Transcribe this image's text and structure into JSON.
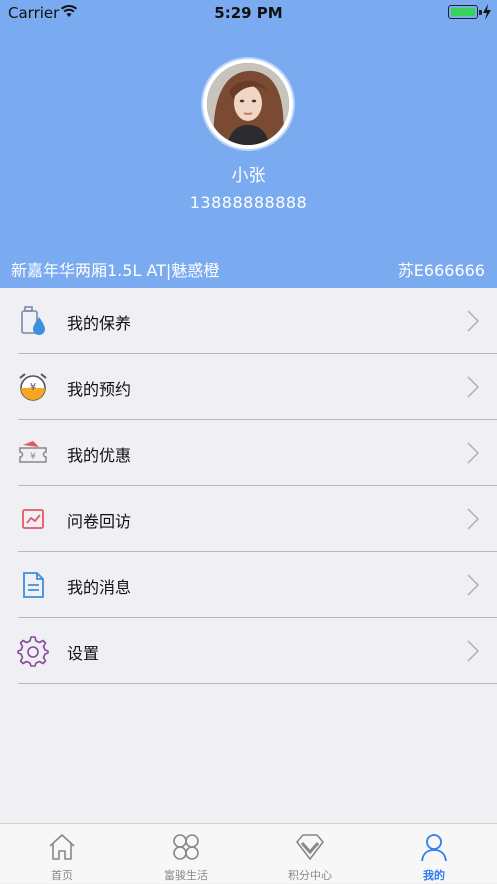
{
  "status_bar": {
    "carrier": "Carrier",
    "time": "5:29 PM"
  },
  "profile": {
    "name": "小张",
    "phone": "13888888888",
    "car_model": "新嘉年华两厢1.5L  AT|魅惑橙",
    "plate": "苏E666666"
  },
  "menu": [
    {
      "label": "我的保养",
      "icon": "maintenance-oil-icon"
    },
    {
      "label": "我的预约",
      "icon": "alarm-clock-icon"
    },
    {
      "label": "我的优惠",
      "icon": "coupon-ticket-icon"
    },
    {
      "label": "问卷回访",
      "icon": "survey-chart-icon"
    },
    {
      "label": "我的消息",
      "icon": "message-document-icon"
    },
    {
      "label": "设置",
      "icon": "settings-gear-icon"
    }
  ],
  "tabs": [
    {
      "label": "首页",
      "icon": "home-icon"
    },
    {
      "label": "富骏生活",
      "icon": "clover-icon"
    },
    {
      "label": "积分中心",
      "icon": "diamond-icon"
    },
    {
      "label": "我的",
      "icon": "person-icon",
      "active": true
    }
  ],
  "colors": {
    "header": "#7aaaef",
    "accent": "#2f7df0",
    "background": "#efeff4"
  }
}
